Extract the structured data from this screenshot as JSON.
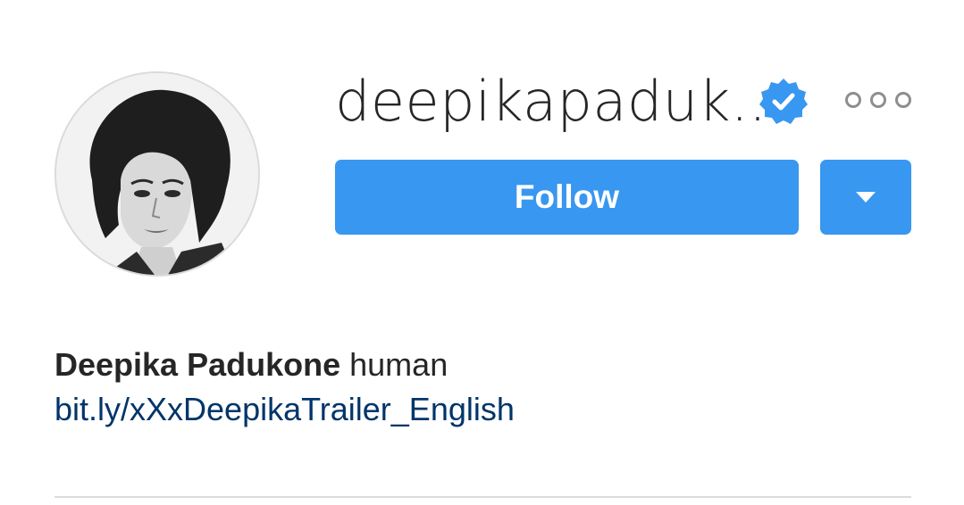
{
  "profile": {
    "username": "deepikapaduk...",
    "verified": true,
    "follow_label": "Follow",
    "full_name": "Deepika Padukone",
    "bio_text": "human",
    "link": "bit.ly/xXxDeepikaTrailer_English"
  },
  "colors": {
    "accent": "#3897f0",
    "link": "#003569",
    "text": "#262626",
    "muted": "#8e8e8e",
    "divider": "#dbdbdb"
  },
  "icons": {
    "verified": "verified-badge-icon",
    "more": "more-options-icon",
    "dropdown": "chevron-down-icon"
  }
}
